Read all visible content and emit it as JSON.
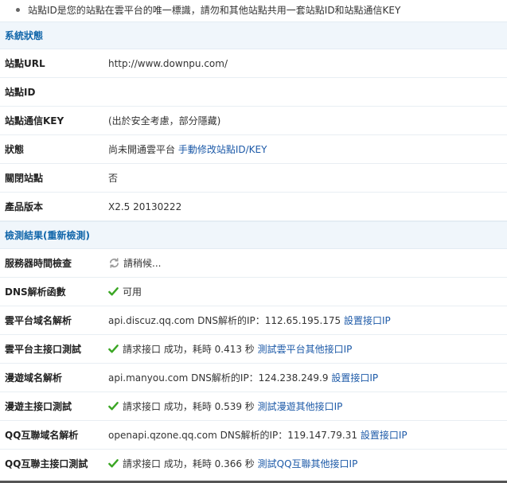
{
  "tip": "站點ID是您的站點在雲平台的唯一標識，請勿和其他站點共用一套站點ID和站點通信KEY",
  "system_status": {
    "title": "系統狀態",
    "rows": [
      {
        "label": "站點URL",
        "value": "http://www.downpu.com/"
      },
      {
        "label": "站點ID",
        "value": ""
      },
      {
        "label": "站點通信KEY",
        "value": "(出於安全考慮，部分隱藏)"
      },
      {
        "label": "狀態",
        "value": "尚未開通雲平台",
        "link": "手動修改站點ID/KEY"
      },
      {
        "label": "關閉站點",
        "value": "否"
      },
      {
        "label": "產品版本",
        "value": "X2.5 20130222"
      }
    ]
  },
  "check_results": {
    "title": "檢測結果",
    "recheck_open": "(",
    "recheck_link": "重新檢測",
    "recheck_close": ")",
    "rows": [
      {
        "label": "服務器時間檢查",
        "icon": "refresh-icon",
        "value": "請稍候..."
      },
      {
        "label": "DNS解析函數",
        "icon": "check-icon",
        "value": "可用"
      },
      {
        "label": "雲平台域名解析",
        "value": "api.discuz.qq.com DNS解析的IP：112.65.195.175",
        "link": "設置接口IP"
      },
      {
        "label": "雲平台主接口測試",
        "icon": "check-icon",
        "value": "請求接口 成功，耗時 0.413 秒",
        "link": "測試雲平台其他接口IP"
      },
      {
        "label": "漫遊域名解析",
        "value": "api.manyou.com DNS解析的IP：124.238.249.9",
        "link": "設置接口IP"
      },
      {
        "label": "漫遊主接口測試",
        "icon": "check-icon",
        "value": "請求接口 成功，耗時 0.539 秒",
        "link": "測試漫遊其他接口IP"
      },
      {
        "label": "QQ互聯域名解析",
        "value": "openapi.qzone.qq.com DNS解析的IP：119.147.79.31",
        "link": "設置接口IP"
      },
      {
        "label": "QQ互聯主接口測試",
        "icon": "check-icon",
        "value": "請求接口 成功，耗時 0.366 秒",
        "link": "測試QQ互聯其他接口IP"
      }
    ]
  },
  "colors": {
    "link": "#1d5aa8",
    "section_bg": "#f0f6fb",
    "section_text": "#1166aa",
    "check": "#3aa623"
  }
}
